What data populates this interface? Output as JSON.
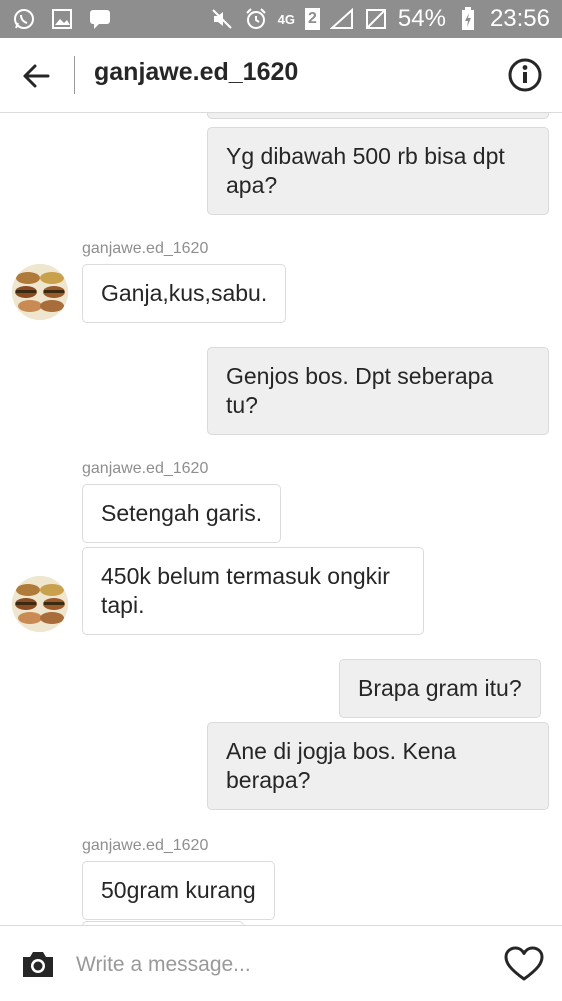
{
  "status_bar": {
    "left_icons": [
      "whatsapp-icon",
      "image-icon",
      "chat-icon"
    ],
    "network": "4G",
    "sim": "2",
    "battery": "54%",
    "time": "23:56"
  },
  "header": {
    "title": "ganjawe.ed_1620"
  },
  "messages": [
    {
      "dir": "out",
      "text": "Yg dibawah 500 rb bisa dpt apa?"
    },
    {
      "dir": "in",
      "sender": "ganjawe.ed_1620",
      "text": "Ganja,kus,sabu."
    },
    {
      "dir": "out",
      "text": "Genjos bos. Dpt seberapa tu?"
    },
    {
      "dir": "in",
      "sender": "ganjawe.ed_1620",
      "text": "Setengah garis."
    },
    {
      "dir": "in",
      "text": "450k belum termasuk ongkir tapi."
    },
    {
      "dir": "out",
      "text": "Brapa gram itu?"
    },
    {
      "dir": "out",
      "text": "Ane di jogja bos. Kena berapa?"
    },
    {
      "dir": "in",
      "sender": "ganjawe.ed_1620",
      "text": "50gram kurang"
    }
  ],
  "composer": {
    "placeholder": "Write a message..."
  },
  "colors": {
    "status_bar": "#8e8e8e",
    "outgoing_bubble": "#efefef",
    "incoming_bubble": "#ffffff",
    "meta_text": "#8e8e8e"
  }
}
